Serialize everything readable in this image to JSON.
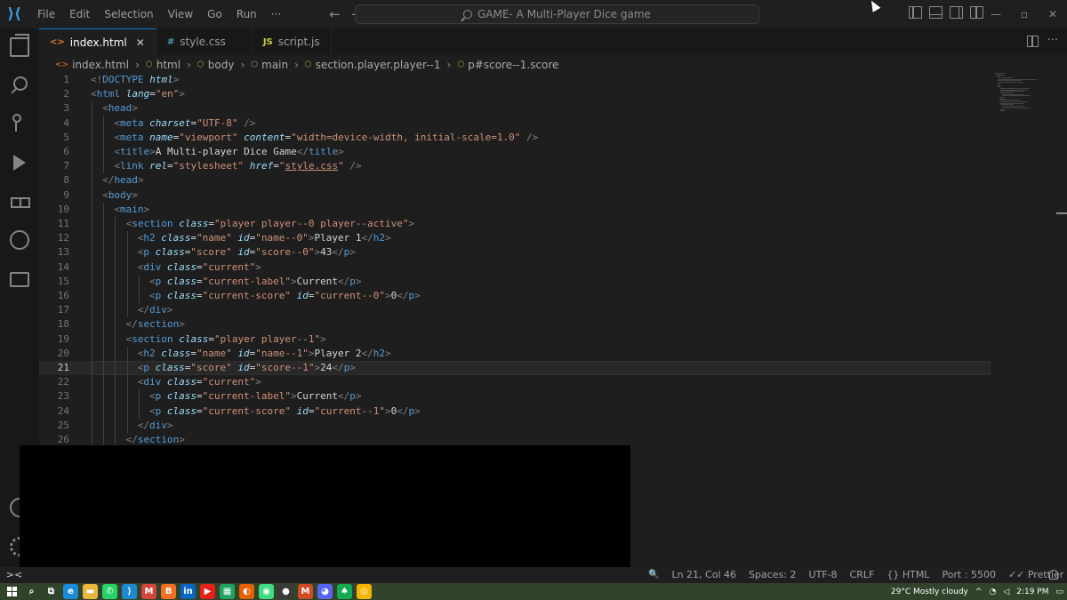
{
  "titlebar": {
    "menu": [
      "File",
      "Edit",
      "Selection",
      "View",
      "Go",
      "Run",
      "···"
    ],
    "nav_back": "←",
    "nav_forward": "→",
    "command_center": "GAME- A Multi-Player Dice game",
    "win_minimize": "—",
    "win_maximize": "▫",
    "win_close": "✕"
  },
  "tabs": [
    {
      "icon": "<>",
      "label": "index.html",
      "close": "✕",
      "active": true
    },
    {
      "icon": "#",
      "label": "style.css",
      "active": false
    },
    {
      "icon": "JS",
      "label": "script.js",
      "active": false
    }
  ],
  "tab_more": "···",
  "breadcrumb": [
    {
      "icon": "<>",
      "label": "index.html"
    },
    {
      "icon": "⬡",
      "label": "html"
    },
    {
      "icon": "⬡",
      "label": "body"
    },
    {
      "icon": "⬡",
      "label": "main"
    },
    {
      "icon": "⬡",
      "label": "section.player.player--1"
    },
    {
      "icon": "⬡",
      "label": "p#score--1.score"
    }
  ],
  "breadcrumb_sep": "›",
  "code": {
    "current_line": 21,
    "lines": [
      {
        "n": "1",
        "indent": 0,
        "parts": [
          [
            "tag",
            "<!"
          ],
          [
            "name",
            "DOCTYPE"
          ],
          [
            "text",
            " "
          ],
          [
            "attr",
            "html"
          ],
          [
            "tag",
            ">"
          ]
        ]
      },
      {
        "n": "2",
        "indent": 0,
        "parts": [
          [
            "tag",
            "<"
          ],
          [
            "name",
            "html"
          ],
          [
            "text",
            " "
          ],
          [
            "attr",
            "lang"
          ],
          [
            "text",
            "="
          ],
          [
            "str",
            "\"en\""
          ],
          [
            "tag",
            ">"
          ]
        ]
      },
      {
        "n": "3",
        "indent": 1,
        "parts": [
          [
            "tag",
            "<"
          ],
          [
            "name",
            "head"
          ],
          [
            "tag",
            ">"
          ]
        ]
      },
      {
        "n": "4",
        "indent": 2,
        "parts": [
          [
            "tag",
            "<"
          ],
          [
            "name",
            "meta"
          ],
          [
            "text",
            " "
          ],
          [
            "attr",
            "charset"
          ],
          [
            "text",
            "="
          ],
          [
            "str",
            "\"UTF-8\""
          ],
          [
            "text",
            " "
          ],
          [
            "tag",
            "/>"
          ]
        ]
      },
      {
        "n": "5",
        "indent": 2,
        "parts": [
          [
            "tag",
            "<"
          ],
          [
            "name",
            "meta"
          ],
          [
            "text",
            " "
          ],
          [
            "attr",
            "name"
          ],
          [
            "text",
            "="
          ],
          [
            "str",
            "\"viewport\""
          ],
          [
            "text",
            " "
          ],
          [
            "attr",
            "content"
          ],
          [
            "text",
            "="
          ],
          [
            "str",
            "\"width=device-width, initial-scale=1.0\""
          ],
          [
            "text",
            " "
          ],
          [
            "tag",
            "/>"
          ]
        ]
      },
      {
        "n": "6",
        "indent": 2,
        "parts": [
          [
            "tag",
            "<"
          ],
          [
            "name",
            "title"
          ],
          [
            "tag",
            ">"
          ],
          [
            "text",
            "A Multi-player Dice Game"
          ],
          [
            "tag",
            "</"
          ],
          [
            "name",
            "title"
          ],
          [
            "tag",
            ">"
          ]
        ]
      },
      {
        "n": "7",
        "indent": 2,
        "parts": [
          [
            "tag",
            "<"
          ],
          [
            "name",
            "link"
          ],
          [
            "text",
            " "
          ],
          [
            "attr",
            "rel"
          ],
          [
            "text",
            "="
          ],
          [
            "str",
            "\"stylesheet\""
          ],
          [
            "text",
            " "
          ],
          [
            "attr",
            "href"
          ],
          [
            "text",
            "="
          ],
          [
            "str",
            "\""
          ],
          [
            "link",
            "style.css"
          ],
          [
            "str",
            "\""
          ],
          [
            "text",
            " "
          ],
          [
            "tag",
            "/>"
          ]
        ]
      },
      {
        "n": "8",
        "indent": 1,
        "parts": [
          [
            "tag",
            "</"
          ],
          [
            "name",
            "head"
          ],
          [
            "tag",
            ">"
          ]
        ]
      },
      {
        "n": "9",
        "indent": 1,
        "parts": [
          [
            "tag",
            "<"
          ],
          [
            "name",
            "body"
          ],
          [
            "tag",
            ">"
          ]
        ]
      },
      {
        "n": "10",
        "indent": 2,
        "parts": [
          [
            "tag",
            "<"
          ],
          [
            "name",
            "main"
          ],
          [
            "tag",
            ">"
          ]
        ]
      },
      {
        "n": "11",
        "indent": 3,
        "parts": [
          [
            "tag",
            "<"
          ],
          [
            "name",
            "section"
          ],
          [
            "text",
            " "
          ],
          [
            "attr",
            "class"
          ],
          [
            "text",
            "="
          ],
          [
            "str",
            "\"player player--0 player--active\""
          ],
          [
            "tag",
            ">"
          ]
        ]
      },
      {
        "n": "12",
        "indent": 4,
        "parts": [
          [
            "tag",
            "<"
          ],
          [
            "name",
            "h2"
          ],
          [
            "text",
            " "
          ],
          [
            "attr",
            "class"
          ],
          [
            "text",
            "="
          ],
          [
            "str",
            "\"name\""
          ],
          [
            "text",
            " "
          ],
          [
            "attr",
            "id"
          ],
          [
            "text",
            "="
          ],
          [
            "str",
            "\"name--0\""
          ],
          [
            "tag",
            ">"
          ],
          [
            "text",
            "Player 1"
          ],
          [
            "tag",
            "</"
          ],
          [
            "name",
            "h2"
          ],
          [
            "tag",
            ">"
          ]
        ]
      },
      {
        "n": "13",
        "indent": 4,
        "parts": [
          [
            "tag",
            "<"
          ],
          [
            "name",
            "p"
          ],
          [
            "text",
            " "
          ],
          [
            "attr",
            "class"
          ],
          [
            "text",
            "="
          ],
          [
            "str",
            "\"score\""
          ],
          [
            "text",
            " "
          ],
          [
            "attr",
            "id"
          ],
          [
            "text",
            "="
          ],
          [
            "str",
            "\"score--0\""
          ],
          [
            "tag",
            ">"
          ],
          [
            "text",
            "43"
          ],
          [
            "tag",
            "</"
          ],
          [
            "name",
            "p"
          ],
          [
            "tag",
            ">"
          ]
        ]
      },
      {
        "n": "14",
        "indent": 4,
        "parts": [
          [
            "tag",
            "<"
          ],
          [
            "name",
            "div"
          ],
          [
            "text",
            " "
          ],
          [
            "attr",
            "class"
          ],
          [
            "text",
            "="
          ],
          [
            "str",
            "\"current\""
          ],
          [
            "tag",
            ">"
          ]
        ]
      },
      {
        "n": "15",
        "indent": 5,
        "parts": [
          [
            "tag",
            "<"
          ],
          [
            "name",
            "p"
          ],
          [
            "text",
            " "
          ],
          [
            "attr",
            "class"
          ],
          [
            "text",
            "="
          ],
          [
            "str",
            "\"current-label\""
          ],
          [
            "tag",
            ">"
          ],
          [
            "text",
            "Current"
          ],
          [
            "tag",
            "</"
          ],
          [
            "name",
            "p"
          ],
          [
            "tag",
            ">"
          ]
        ]
      },
      {
        "n": "16",
        "indent": 5,
        "parts": [
          [
            "tag",
            "<"
          ],
          [
            "name",
            "p"
          ],
          [
            "text",
            " "
          ],
          [
            "attr",
            "class"
          ],
          [
            "text",
            "="
          ],
          [
            "str",
            "\"current-score\""
          ],
          [
            "text",
            " "
          ],
          [
            "attr",
            "id"
          ],
          [
            "text",
            "="
          ],
          [
            "str",
            "\"current--0\""
          ],
          [
            "tag",
            ">"
          ],
          [
            "text",
            "0"
          ],
          [
            "tag",
            "</"
          ],
          [
            "name",
            "p"
          ],
          [
            "tag",
            ">"
          ]
        ]
      },
      {
        "n": "17",
        "indent": 4,
        "parts": [
          [
            "tag",
            "</"
          ],
          [
            "name",
            "div"
          ],
          [
            "tag",
            ">"
          ]
        ]
      },
      {
        "n": "18",
        "indent": 3,
        "parts": [
          [
            "tag",
            "</"
          ],
          [
            "name",
            "section"
          ],
          [
            "tag",
            ">"
          ]
        ]
      },
      {
        "n": "19",
        "indent": 3,
        "parts": [
          [
            "tag",
            "<"
          ],
          [
            "name",
            "section"
          ],
          [
            "text",
            " "
          ],
          [
            "attr",
            "class"
          ],
          [
            "text",
            "="
          ],
          [
            "str",
            "\"player player--1\""
          ],
          [
            "tag",
            ">"
          ]
        ]
      },
      {
        "n": "20",
        "indent": 4,
        "parts": [
          [
            "tag",
            "<"
          ],
          [
            "name",
            "h2"
          ],
          [
            "text",
            " "
          ],
          [
            "attr",
            "class"
          ],
          [
            "text",
            "="
          ],
          [
            "str",
            "\"name\""
          ],
          [
            "text",
            " "
          ],
          [
            "attr",
            "id"
          ],
          [
            "text",
            "="
          ],
          [
            "str",
            "\"name--1\""
          ],
          [
            "tag",
            ">"
          ],
          [
            "text",
            "Player 2"
          ],
          [
            "tag",
            "</"
          ],
          [
            "name",
            "h2"
          ],
          [
            "tag",
            ">"
          ]
        ]
      },
      {
        "n": "21",
        "indent": 4,
        "parts": [
          [
            "tag",
            "<"
          ],
          [
            "name",
            "p"
          ],
          [
            "text",
            " "
          ],
          [
            "attr",
            "class"
          ],
          [
            "text",
            "="
          ],
          [
            "str",
            "\"score\""
          ],
          [
            "text",
            " "
          ],
          [
            "attr",
            "id"
          ],
          [
            "text",
            "="
          ],
          [
            "str",
            "\"score--1\""
          ],
          [
            "tag",
            ">"
          ],
          [
            "text",
            "24"
          ],
          [
            "tag",
            "</"
          ],
          [
            "name",
            "p"
          ],
          [
            "tag",
            ">"
          ]
        ]
      },
      {
        "n": "22",
        "indent": 4,
        "parts": [
          [
            "tag",
            "<"
          ],
          [
            "name",
            "div"
          ],
          [
            "text",
            " "
          ],
          [
            "attr",
            "class"
          ],
          [
            "text",
            "="
          ],
          [
            "str",
            "\"current\""
          ],
          [
            "tag",
            ">"
          ]
        ]
      },
      {
        "n": "23",
        "indent": 5,
        "parts": [
          [
            "tag",
            "<"
          ],
          [
            "name",
            "p"
          ],
          [
            "text",
            " "
          ],
          [
            "attr",
            "class"
          ],
          [
            "text",
            "="
          ],
          [
            "str",
            "\"current-label\""
          ],
          [
            "tag",
            ">"
          ],
          [
            "text",
            "Current"
          ],
          [
            "tag",
            "</"
          ],
          [
            "name",
            "p"
          ],
          [
            "tag",
            ">"
          ]
        ]
      },
      {
        "n": "24",
        "indent": 5,
        "parts": [
          [
            "tag",
            "<"
          ],
          [
            "name",
            "p"
          ],
          [
            "text",
            " "
          ],
          [
            "attr",
            "class"
          ],
          [
            "text",
            "="
          ],
          [
            "str",
            "\"current-score\""
          ],
          [
            "text",
            " "
          ],
          [
            "attr",
            "id"
          ],
          [
            "text",
            "="
          ],
          [
            "str",
            "\"current--1\""
          ],
          [
            "tag",
            ">"
          ],
          [
            "text",
            "0"
          ],
          [
            "tag",
            "</"
          ],
          [
            "name",
            "p"
          ],
          [
            "tag",
            ">"
          ]
        ]
      },
      {
        "n": "25",
        "indent": 4,
        "parts": [
          [
            "tag",
            "</"
          ],
          [
            "name",
            "div"
          ],
          [
            "tag",
            ">"
          ]
        ]
      },
      {
        "n": "26",
        "indent": 3,
        "parts": [
          [
            "tag",
            "</"
          ],
          [
            "name",
            "section"
          ],
          [
            "tag",
            ">"
          ]
        ]
      }
    ]
  },
  "statusbar": {
    "remote": "><",
    "zoom_icon": "🔍",
    "position": "Ln 21, Col 46",
    "spaces": "Spaces: 2",
    "encoding": "UTF-8",
    "eol": "CRLF",
    "language": "{} HTML",
    "port": "Port : 5500",
    "prettier": "✓✓ Prettier"
  },
  "taskbar": {
    "apps": [
      {
        "name": "search-icon",
        "glyph": "⌕",
        "color": "#31432a"
      },
      {
        "name": "task-view-icon",
        "glyph": "⧉",
        "color": "#31432a"
      },
      {
        "name": "edge-icon",
        "glyph": "e",
        "color": "#1b8bd8"
      },
      {
        "name": "file-explorer-icon",
        "glyph": "▬",
        "color": "#e8b53f"
      },
      {
        "name": "whatsapp-icon",
        "glyph": "✆",
        "color": "#25d366"
      },
      {
        "name": "vscode-icon",
        "glyph": "⟩",
        "color": "#1f8ad2"
      },
      {
        "name": "gmail-icon",
        "glyph": "M",
        "color": "#d6453d"
      },
      {
        "name": "brave-icon",
        "glyph": "B",
        "color": "#f36f21"
      },
      {
        "name": "linkedin-icon",
        "glyph": "in",
        "color": "#0a66c2"
      },
      {
        "name": "youtube-icon",
        "glyph": "▶",
        "color": "#e62117"
      },
      {
        "name": "sheets-icon",
        "glyph": "▦",
        "color": "#1ea362"
      },
      {
        "name": "firefox-icon",
        "glyph": "◐",
        "color": "#e66000"
      },
      {
        "name": "android-studio-icon",
        "glyph": "◉",
        "color": "#3ddc84"
      },
      {
        "name": "obs-icon",
        "glyph": "●",
        "color": "#3a3a3a"
      },
      {
        "name": "ms-office-icon",
        "glyph": "M",
        "color": "#d04a23"
      },
      {
        "name": "discord-icon",
        "glyph": "◕",
        "color": "#5865f2"
      },
      {
        "name": "mongodb-icon",
        "glyph": "♠",
        "color": "#13aa52"
      },
      {
        "name": "chrome-icon",
        "glyph": "◎",
        "color": "#f4b400"
      }
    ],
    "weather": "29°C  Mostly cloudy",
    "tray_arrow": "^",
    "time": "2:19 PM",
    "notifications": "▭"
  }
}
